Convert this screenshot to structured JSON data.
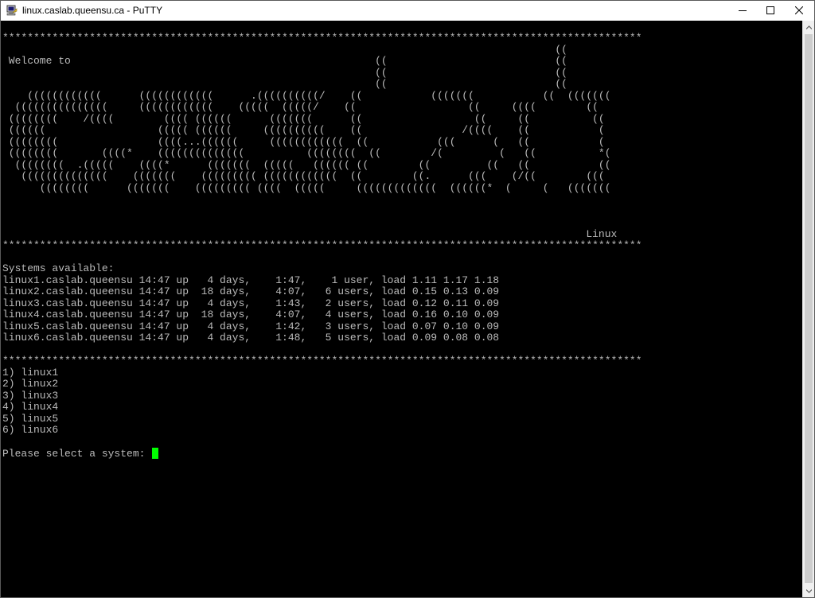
{
  "window": {
    "title": "linux.caslab.queensu.ca - PuTTY"
  },
  "icons": {
    "app": "putty-icon",
    "minimize": "minimize-icon",
    "maximize": "maximize-icon",
    "close": "close-icon",
    "scroll_up": "arrow-up-icon",
    "scroll_down": "arrow-down-icon"
  },
  "colors": {
    "terminal_bg": "#000000",
    "terminal_text": "#bbbbbb",
    "cursor": "#00ff00"
  },
  "terminal": {
    "lines": [
      "*******************************************************************************************************",
      "                                                                                         ((",
      " Welcome to                                                 ((                           ((",
      "                                                            ((                           ((",
      "                                                            ((                           ((",
      "    ((((((((((((      ((((((((((((      .((((((((((/    ((           (((((((           ((  (((((((",
      "  (((((((((((((((     ((((((((((((    (((((  (((((/    ((                  ((     ((((        ((",
      " ((((((((    /((((        (((( ((((((      (((((((      ((                  ((     ((          ((",
      " ((((((                  ((((( ((((((     ((((((((((    ((                /((((    ((           (",
      " ((((((((                ((((...((((((     ((((((((((((  ((           (((      (   ((           (",
      " ((((((((       ((((*    ((((((((((((((          ((((((((  ((        /(         (   ((          *(",
      "  ((((((((  .(((((    ((((*      (((((((  (((((   (((((( ((        ((         ((   ((           ((",
      "   ((((((((((((((    (((((((    ((((((((( ((((((((((((  ((        ((.      (((    (/((        (((",
      "      ((((((((      (((((((    ((((((((( ((((  (((((     (((((((((((((  ((((((*  (     (   (((((((",
      "",
      "",
      "",
      "                                                                                              Linux",
      "*******************************************************************************************************",
      "",
      "Systems available:",
      "linux1.caslab.queensu 14:47 up   4 days,    1:47,    1 user, load 1.11 1.17 1.18",
      "linux2.caslab.queensu 14:47 up  18 days,    4:07,   6 users, load 0.15 0.13 0.09",
      "linux3.caslab.queensu 14:47 up   4 days,    1:43,   2 users, load 0.12 0.11 0.09",
      "linux4.caslab.queensu 14:47 up  18 days,    4:07,   4 users, load 0.16 0.10 0.09",
      "linux5.caslab.queensu 14:47 up   4 days,    1:42,   3 users, load 0.07 0.10 0.09",
      "linux6.caslab.queensu 14:47 up   4 days,    1:48,   5 users, load 0.09 0.08 0.08",
      "",
      "*******************************************************************************************************",
      "1) linux1",
      "2) linux2",
      "3) linux3",
      "4) linux4",
      "5) linux5",
      "6) linux6",
      ""
    ],
    "prompt": "Please select a system: "
  }
}
